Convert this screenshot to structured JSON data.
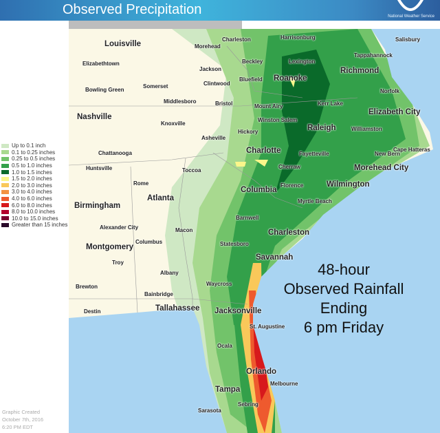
{
  "header": {
    "title": "Observed Precipitation",
    "agency": "National Weather Service"
  },
  "legend": [
    {
      "label": "Up to 0.1 inch",
      "color": "#cfe8c4"
    },
    {
      "label": "0.1 to 0.25 inches",
      "color": "#a8d98f"
    },
    {
      "label": "0.25 to 0.5 inches",
      "color": "#72c36a"
    },
    {
      "label": "0.5 to 1.0 inches",
      "color": "#33a04a"
    },
    {
      "label": "1.0 to 1.5 inches",
      "color": "#0a6a2a"
    },
    {
      "label": "1.5 to 2.0 inches",
      "color": "#fbf68a"
    },
    {
      "label": "2.0 to 3.0 inches",
      "color": "#f9c85a"
    },
    {
      "label": "3.0 to 4.0 inches",
      "color": "#f39242"
    },
    {
      "label": "4.0 to 6.0 inches",
      "color": "#ee5a2e"
    },
    {
      "label": "6.0 to 8.0 inches",
      "color": "#d7191c"
    },
    {
      "label": "8.0 to 10.0 inches",
      "color": "#b3002d"
    },
    {
      "label": "10.0 to 15.0 inches",
      "color": "#7a0030"
    },
    {
      "label": "Greater than 15 inches",
      "color": "#2a0a2a"
    }
  ],
  "annotation": [
    "48-hour",
    "Observed Rainfall",
    "Ending",
    "6 pm Friday"
  ],
  "footer": [
    "Graphic Created",
    "October 7th, 2016",
    "6:20 PM EDT"
  ],
  "cities": [
    "Louisville",
    "Morehead",
    "Charleston",
    "Harrisonburg",
    "Salisbury",
    "Elizabethtown",
    "Jackson",
    "Beckley",
    "Lexington",
    "Tappahannock",
    "Richmond",
    "Bowling Green",
    "Somerset",
    "Clintwood",
    "Bluefield",
    "Roanoke",
    "Norfolk",
    "Middlesboro",
    "Bristol",
    "Mount Airy",
    "Kerr Lake",
    "Elizabeth City",
    "Nashville",
    "Knoxville",
    "Winston Salem",
    "Raleigh",
    "Williamston",
    "Asheville",
    "Hickory",
    "Cape Hatteras",
    "Chattanooga",
    "Charlotte",
    "Fayetteville",
    "New Bern",
    "Huntsville",
    "Toccoa",
    "Cherraw",
    "Morehead City",
    "Rome",
    "Atlanta",
    "Columbia",
    "Florence",
    "Wilmington",
    "Birmingham",
    "Myrtle Beach",
    "Barnwell",
    "Alexander City",
    "Macon",
    "Charleston",
    "Montgomery",
    "Columbus",
    "Statesboro",
    "Savannah",
    "Troy",
    "Albany",
    "Waycross",
    "Brewton",
    "Bainbridge",
    "Tallahassee",
    "Destin",
    "Jacksonville",
    "St. Augustine",
    "Ocala",
    "Orlando",
    "Melbourne",
    "Tampa",
    "Sebring",
    "Sarasota"
  ]
}
